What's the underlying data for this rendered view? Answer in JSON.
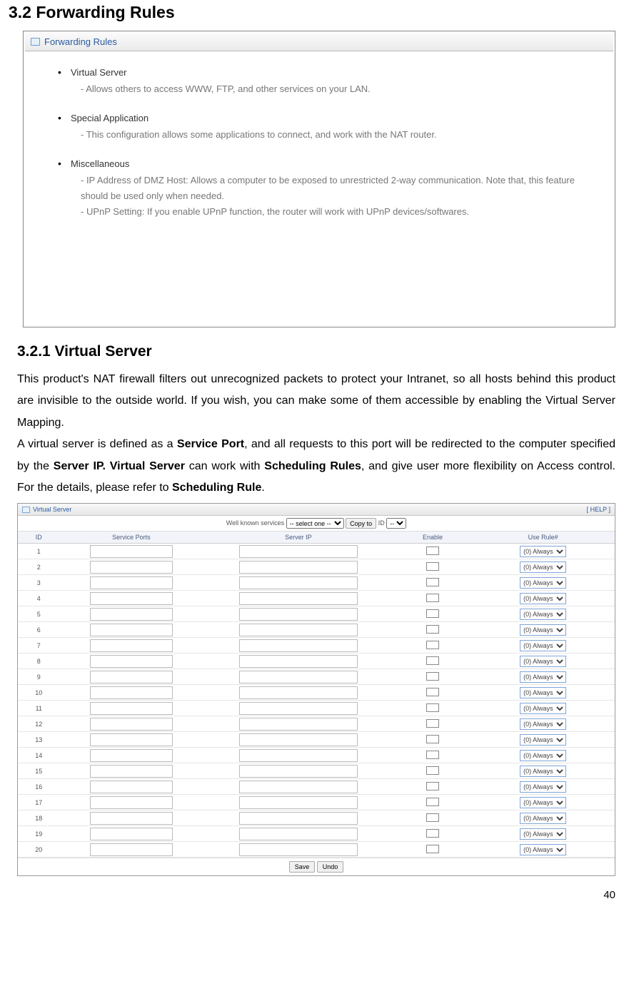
{
  "section": {
    "number_title": "3.2 Forwarding Rules"
  },
  "panel1": {
    "title": "Forwarding Rules",
    "items": [
      {
        "head": "Virtual Server",
        "desc": "- Allows others to access WWW, FTP, and other services on your LAN."
      },
      {
        "head": "Special Application",
        "desc": "- This configuration allows some applications to connect, and work with the NAT router."
      },
      {
        "head": "Miscellaneous",
        "desc": "- IP Address of DMZ Host: Allows a computer to be exposed to unrestricted 2-way communication. Note that, this feature should be used only when needed.\n- UPnP Setting: If you enable UPnP function, the router will work with UPnP devices/softwares."
      }
    ]
  },
  "subsection": {
    "title": "3.2.1 Virtual Server"
  },
  "body": {
    "p1a": "This product's NAT firewall filters out unrecognized packets to protect your Intranet, so all hosts behind this product are invisible to the outside world. If you wish, you can make some of them accessible by enabling the Virtual Server Mapping.",
    "p2a": "A virtual server is defined as a ",
    "p2b": "Service Port",
    "p2c": ", and all requests to this port will be redirected to the computer specified by the ",
    "p2d": "Server IP. Virtual Server",
    "p2e": " can work with ",
    "p2f": "Scheduling Rules",
    "p2g": ", and give user more flexibility on Access control. For the details, please refer to ",
    "p2h": "Scheduling Rule",
    "p2i": "."
  },
  "vs": {
    "title": "Virtual Server",
    "help": "[ HELP ]",
    "well_label": "Well known services",
    "select_one": "-- select one --",
    "copy_to": "Copy to",
    "id_label": "ID",
    "id_sel": "--",
    "headers": {
      "id": "ID",
      "ports": "Service Ports",
      "ip": "Server IP",
      "enable": "Enable",
      "rule": "Use Rule#"
    },
    "rule_option": "(0) Always",
    "rows": [
      1,
      2,
      3,
      4,
      5,
      6,
      7,
      8,
      9,
      10,
      11,
      12,
      13,
      14,
      15,
      16,
      17,
      18,
      19,
      20
    ],
    "save": "Save",
    "undo": "Undo"
  },
  "page_number": "40"
}
